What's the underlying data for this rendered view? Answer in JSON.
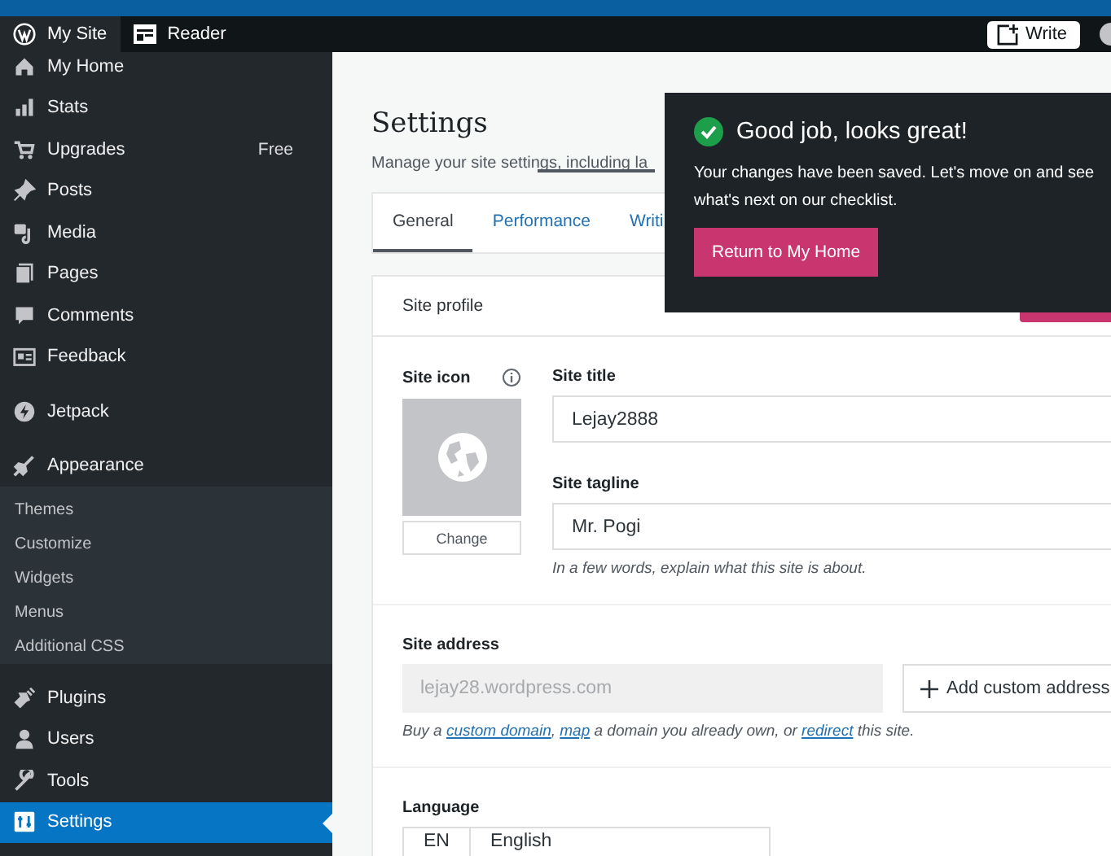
{
  "top_bar": {
    "site": "My Site",
    "reader": "Reader",
    "write": "Write"
  },
  "sidebar": {
    "groups": [
      [
        {
          "label": "My Home",
          "selected": false
        },
        {
          "label": "Stats",
          "selected": false
        },
        {
          "label": "Upgrades",
          "badge": "Free",
          "selected": false
        },
        {
          "label": "Posts",
          "selected": false
        },
        {
          "label": "Media",
          "selected": false
        },
        {
          "label": "Pages",
          "selected": false
        },
        {
          "label": "Comments",
          "selected": false
        },
        {
          "label": "Feedback",
          "selected": false
        }
      ],
      [
        {
          "label": "Jetpack",
          "selected": false
        }
      ],
      [
        {
          "label": "Appearance",
          "selected": false,
          "children": [
            {
              "label": "Themes",
              "selected": false
            },
            {
              "label": "Customize",
              "selected": false
            },
            {
              "label": "Widgets",
              "selected": false
            },
            {
              "label": "Menus",
              "selected": false
            },
            {
              "label": "Additional CSS",
              "selected": false
            }
          ]
        }
      ],
      [
        {
          "label": "Plugins",
          "selected": false
        },
        {
          "label": "Users",
          "selected": false
        },
        {
          "label": "Tools",
          "selected": false
        },
        {
          "label": "Settings",
          "selected": true
        }
      ]
    ]
  },
  "header": {
    "title": "Settings",
    "subtitle": "Manage your site settings, including la"
  },
  "tabs": [
    {
      "label": "General",
      "selected": true
    },
    {
      "label": "Performance",
      "selected": false
    },
    {
      "label": "Writi",
      "selected": false
    }
  ],
  "notice": {
    "title": "Good job, looks great!",
    "message": "Your changes have been saved. Let's move on and see what's next on our checklist.",
    "button": "Return to My Home"
  },
  "site_profile": {
    "title": "Site profile",
    "site_icon_label": "Site icon",
    "change_button": "Change",
    "site_title_label": "Site title",
    "site_title": "Lejay2888",
    "tagline_label": "Site tagline",
    "tagline": "Mr. Pogi",
    "tagline_hint": "In a few words, explain what this site is about.",
    "address_label": "Site address",
    "address": "lejay28.wordpress.com",
    "add_address_button": "Add custom address",
    "address_hint": [
      {
        "kind": "text",
        "text": "Buy a "
      },
      {
        "kind": "link",
        "text": "custom domain"
      },
      {
        "kind": "text",
        "text": ", "
      },
      {
        "kind": "link",
        "text": "map"
      },
      {
        "kind": "text",
        "text": " a domain you already own, or "
      },
      {
        "kind": "link",
        "text": "redirect"
      },
      {
        "kind": "text",
        "text": " this site."
      }
    ],
    "language_label": "Language",
    "language_code": "EN",
    "language_name": "English"
  }
}
